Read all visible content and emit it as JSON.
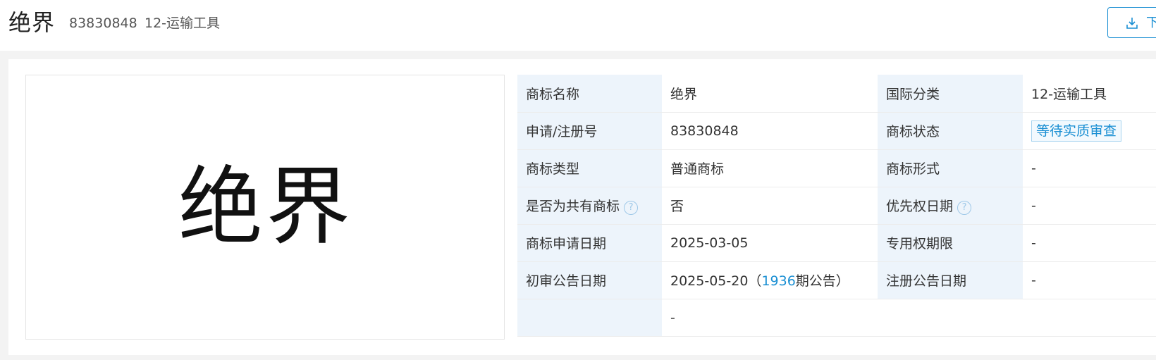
{
  "header": {
    "title": "绝界",
    "reg_no": "83830848",
    "class": "12-运输工具",
    "download_label": "下",
    "download_icon": "download-icon"
  },
  "mark_image": {
    "text": "绝界"
  },
  "details": {
    "name_label": "商标名称",
    "name_value": "绝界",
    "intl_class_label": "国际分类",
    "intl_class_value": "12-运输工具",
    "reg_no_label": "申请/注册号",
    "reg_no_value": "83830848",
    "status_label": "商标状态",
    "status_value": "等待实质审查",
    "type_label": "商标类型",
    "type_value": "普通商标",
    "form_label": "商标形式",
    "form_value": "-",
    "shared_label": "是否为共有商标",
    "shared_value": "否",
    "priority_label": "优先权日期",
    "priority_value": "-",
    "apply_date_label": "商标申请日期",
    "apply_date_value": "2025-03-05",
    "exclusive_label": "专用权期限",
    "exclusive_value": "-",
    "prelim_label": "初审公告日期",
    "prelim_date": "2025-05-20",
    "prelim_open": "（",
    "prelim_issue": "1936",
    "prelim_suffix": "期公告）",
    "reg_pub_label": "注册公告日期",
    "reg_pub_value": "-",
    "last_row_value": "-",
    "help_glyph": "?"
  },
  "colors": {
    "accent": "#1a8fd3",
    "label_bg": "#edf4fb"
  }
}
